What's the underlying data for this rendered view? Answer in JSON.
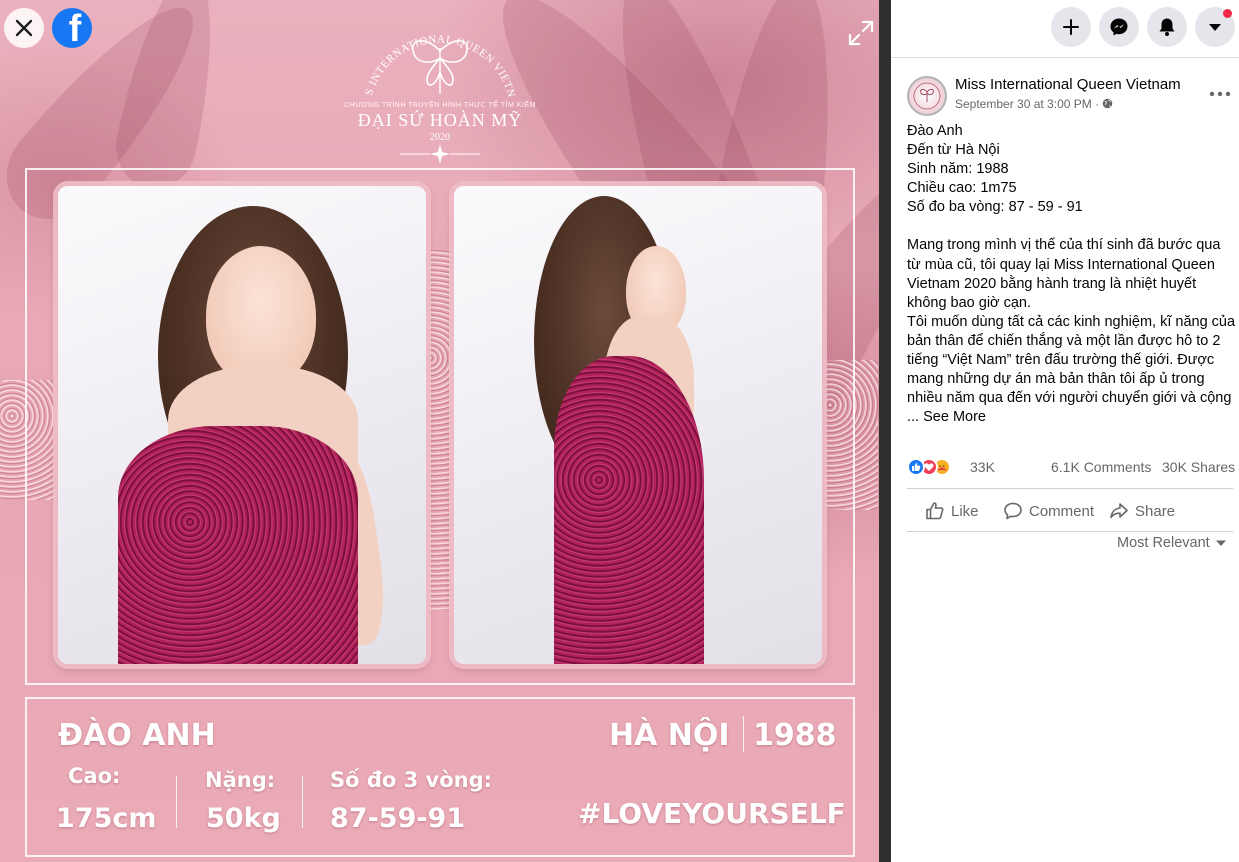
{
  "viewer": {
    "logo": {
      "arc_text": "MISS INTERNATIONAL QUEEN VIETNAM",
      "subtitle": "CHƯƠNG TRÌNH TRUYỀN HÌNH THỰC TẾ TÌM KIẾM",
      "name": "ĐẠI SỨ HOÀN MỸ",
      "year": "2020"
    },
    "card": {
      "contestant_name": "ĐÀO ANH",
      "hometown": "HÀ NỘI",
      "birth_year": "1988",
      "height_label": "Cao:",
      "height_value": "175cm",
      "weight_label": "Nặng:",
      "weight_value": "50kg",
      "measurements_label": "Số đo 3 vòng:",
      "measurements_value": "87-59-91",
      "hashtag": "#LOVEYOURSELF"
    },
    "icons": {
      "close": "close-icon",
      "facebook": "facebook-logo-icon",
      "expand": "expand-icon"
    }
  },
  "topbar": {
    "buttons": [
      "create-icon",
      "messenger-icon",
      "notifications-icon",
      "account-menu-icon"
    ]
  },
  "post": {
    "page_name": "Miss International Queen Vietnam",
    "timestamp": "September 30 at 3:00 PM",
    "separator": "·",
    "privacy_icon": "globe-icon",
    "lines_intro": [
      "Đào Anh",
      "Đến từ Hà Nội",
      "Sinh năm: 1988",
      "Chiều cao: 1m75",
      "Số đo ba vòng: 87 - 59 - 91"
    ],
    "paragraph_1": "Mang trong mình vị thế của thí sinh đã bước qua từ mùa cũ, tôi quay lại Miss International Queen Vietnam 2020 bằng hành trang là nhiệt huyết không bao giờ cạn.",
    "paragraph_2": "Tôi muốn dùng tất cả các kinh nghiệm, kĩ năng của bản thân để chiến thắng và một lần được hô to 2 tiếng “Việt Nam” trên đấu trường thế giới. Được mang những dự án mà bản thân tôi ấp ủ trong nhiều năm qua đến với người chuyển giới và cộng ...",
    "see_more": "See More",
    "reaction_count": "33K",
    "comments": "6.1K Comments",
    "shares": "30K Shares",
    "actions": {
      "like": "Like",
      "comment": "Comment",
      "share": "Share"
    },
    "sort_label": "Most Relevant"
  },
  "colors": {
    "facebook_blue": "#1877f2",
    "viewer_pink": "#e8a9b6",
    "notification_red": "#f02849",
    "secondary_text": "#65676b"
  }
}
